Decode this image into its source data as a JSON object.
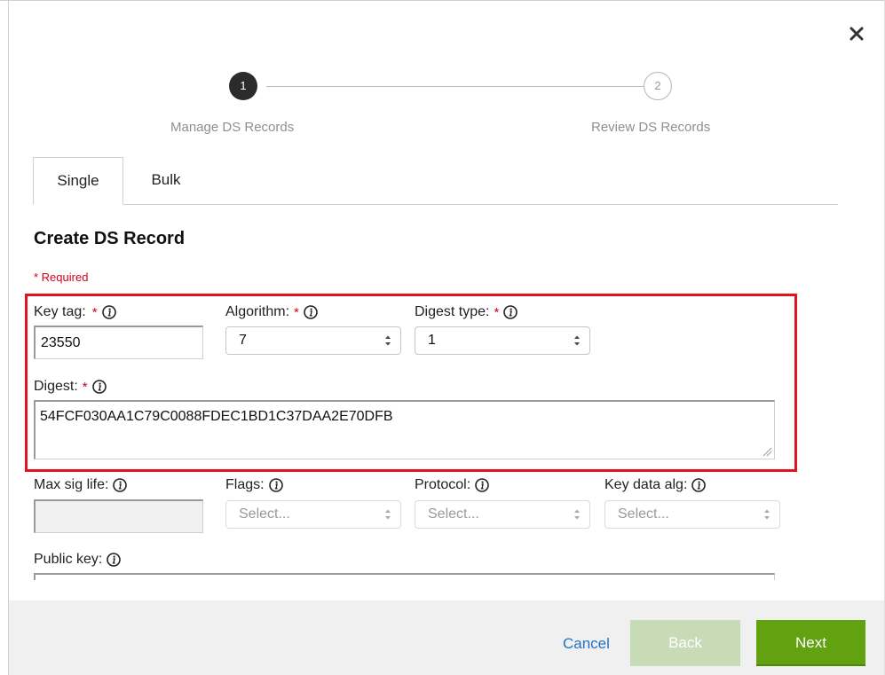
{
  "stepper": {
    "steps": [
      {
        "number": "1",
        "label": "Manage DS Records",
        "state": "active"
      },
      {
        "number": "2",
        "label": "Review DS Records",
        "state": "pending"
      }
    ]
  },
  "tabs": [
    {
      "label": "Single",
      "active": true
    },
    {
      "label": "Bulk",
      "active": false
    }
  ],
  "form": {
    "title": "Create DS Record",
    "required_note": "* Required",
    "required_star": "*",
    "key_tag": {
      "label": "Key tag:",
      "value": "23550"
    },
    "algorithm": {
      "label": "Algorithm:",
      "value": "7"
    },
    "digest_type": {
      "label": "Digest type:",
      "value": "1"
    },
    "digest": {
      "label": "Digest:",
      "value": "54FCF030AA1C79C0088FDEC1BD1C37DAA2E70DFB"
    },
    "max_sig_life": {
      "label": "Max sig life:",
      "value": ""
    },
    "flags": {
      "label": "Flags:",
      "value": "Select..."
    },
    "protocol": {
      "label": "Protocol:",
      "value": "Select..."
    },
    "key_data_alg": {
      "label": "Key data alg:",
      "value": "Select..."
    },
    "public_key": {
      "label": "Public key:"
    }
  },
  "footer": {
    "cancel_label": "Cancel",
    "back_label": "Back",
    "next_label": "Next"
  },
  "colors": {
    "required": "#d0021b",
    "highlight": "#e0141e",
    "link": "#1d74c6",
    "next_button": "#62a10f",
    "back_button_disabled": "#c7dbb7"
  },
  "icons": {
    "close": "close-icon",
    "info": "info-icon",
    "select_arrows": "chevron-updown-icon"
  }
}
